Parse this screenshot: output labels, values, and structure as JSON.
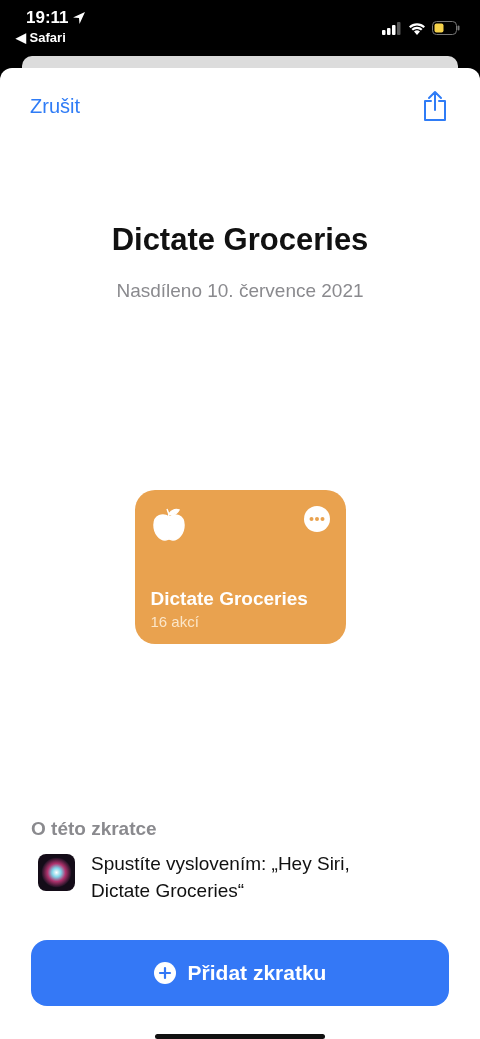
{
  "status_bar": {
    "time": "19:11",
    "back_app": "◀ Safari"
  },
  "sheet": {
    "cancel": "Zrušit"
  },
  "title": "Dictate Groceries",
  "shared_date": "Nasdíleno 10. července 2021",
  "shortcut_card": {
    "name": "Dictate Groceries",
    "actions": "16 akcí",
    "color": "#e9a24f"
  },
  "about": {
    "heading": "O této zkratce",
    "siri_text": "Spustíte vyslovením: „Hey Siri, Dictate Groceries“"
  },
  "add_button": "Přidat zkratku"
}
